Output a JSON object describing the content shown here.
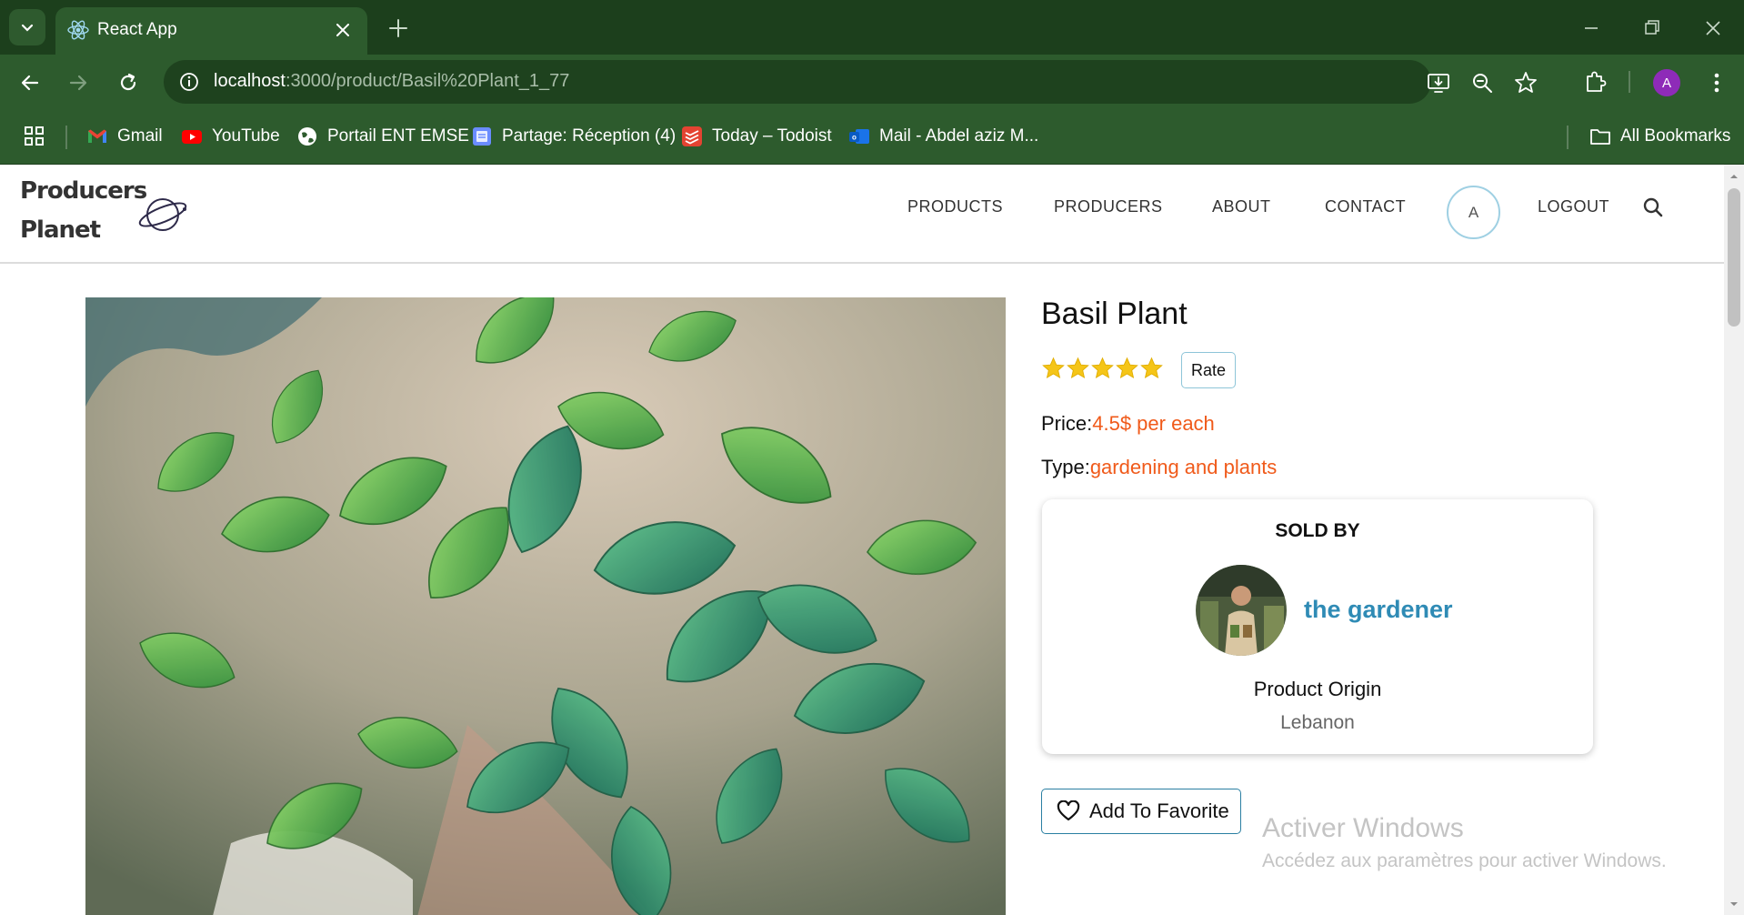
{
  "browser": {
    "tab_title": "React App",
    "url_host": "localhost",
    "url_path": ":3000/product/Basil%20Plant_1_77",
    "profile_initial": "A",
    "colors": {
      "frame": "#1c3f1c",
      "toolbar": "#2d5b2d",
      "omnibox": "#1e421e"
    },
    "bookmarks": [
      {
        "label": "Gmail",
        "icon": "gmail-icon"
      },
      {
        "label": "YouTube",
        "icon": "youtube-icon"
      },
      {
        "label": "Portail ENT EMSE",
        "icon": "globe-icon"
      },
      {
        "label": "Partage: Réception (4)",
        "icon": "mail-doc-icon"
      },
      {
        "label": "Today – Todoist",
        "icon": "todoist-icon"
      },
      {
        "label": "Mail - Abdel aziz M...",
        "icon": "outlook-icon"
      }
    ],
    "all_bookmarks_label": "All Bookmarks"
  },
  "site": {
    "logo_line1": "Producers",
    "logo_line2": "Planet",
    "nav": {
      "products": "PRODUCTS",
      "producers": "PRODUCERS",
      "about": "ABOUT",
      "contact": "CONTACT",
      "avatar_initial": "A",
      "logout": "LOGOUT"
    }
  },
  "product": {
    "title": "Basil Plant",
    "rating": 5,
    "rating_max": 5,
    "rate_label": "Rate",
    "price_label": "Price:",
    "price_value": "4.5$ per each",
    "type_label": "Type:",
    "type_value": "gardening and plants",
    "sold_by_label": "SOLD BY",
    "seller_name": "the gardener",
    "origin_label": "Product Origin",
    "origin_value": "Lebanon",
    "favorite_label": "Add To Favorite",
    "accent_color": "#f05a1a",
    "seller_color": "#2f8bb5"
  },
  "watermark": {
    "title": "Activer Windows",
    "subtitle": "Accédez aux paramètres pour activer Windows."
  }
}
